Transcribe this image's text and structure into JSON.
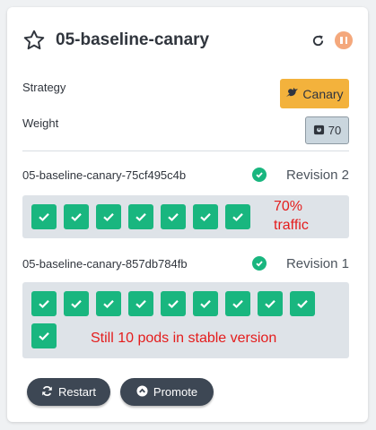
{
  "header": {
    "title": "05-baseline-canary",
    "star_icon": "star-icon",
    "refresh_icon": "refresh-icon",
    "status_icon": "pause-icon",
    "status_color": "#f4a87c"
  },
  "info": {
    "strategy_label": "Strategy",
    "strategy_value": "Canary",
    "strategy_icon": "canary-bird-icon",
    "strategy_color": "#f3b23c",
    "weight_label": "Weight",
    "weight_value": "70",
    "weight_icon": "weight-icon"
  },
  "replicasets": [
    {
      "name": "05-baseline-canary-75cf495c4b",
      "revision": "Revision 2",
      "pods_healthy": 7,
      "annotation": "70%\ntraffic"
    },
    {
      "name": "05-baseline-canary-857db784fb",
      "revision": "Revision 1",
      "pods_healthy": 10,
      "annotation": "Still 10 pods in stable version"
    }
  ],
  "actions": {
    "restart_label": "Restart",
    "promote_label": "Promote"
  },
  "colors": {
    "pod_healthy": "#19b67f",
    "annotation": "#e41c1c",
    "button_bg": "#3d4754"
  }
}
